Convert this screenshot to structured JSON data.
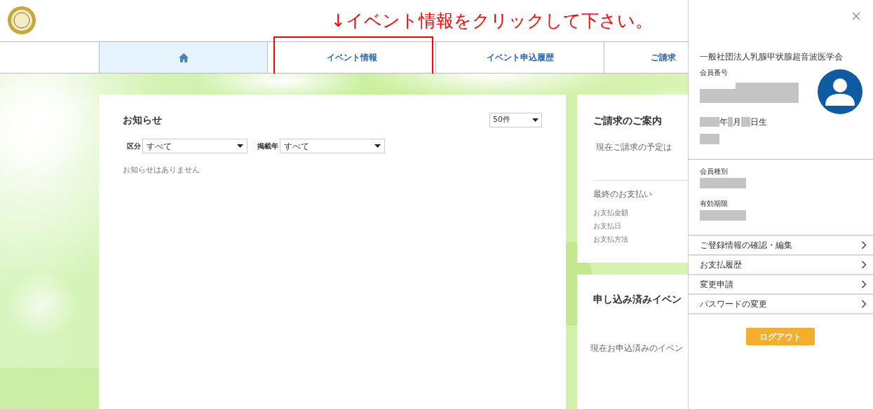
{
  "annotation": {
    "text": "↓イベント情報をクリックして下さい。"
  },
  "nav": [
    {
      "kind": "home",
      "selected": true,
      "annotated": false
    },
    {
      "kind": "text",
      "label": "イベント情報",
      "selected": false,
      "annotated": true
    },
    {
      "kind": "text",
      "label": "イベント申込履歴",
      "selected": false,
      "annotated": false
    },
    {
      "kind": "text",
      "label": "ご請求",
      "selected": false,
      "annotated": false
    }
  ],
  "notices": {
    "title": "お知らせ",
    "per_page": "50件",
    "filters": [
      {
        "label": "区分",
        "value": "すべて"
      },
      {
        "label": "掲載年",
        "value": "すべて"
      }
    ],
    "empty_message": "お知らせはありません"
  },
  "billing": {
    "title": "ご請求のご案内",
    "message": "現在ご請求の予定は",
    "last_payment": {
      "title": "最終のお支払い",
      "fields": [
        "お支払金額",
        "お支払日",
        "お支払方法"
      ]
    }
  },
  "events": {
    "title": "申し込み済みイベン",
    "message": "現在お申込済みのイベン"
  },
  "drawer": {
    "organization": "一般社団法人乳腺甲状腺超音波医学会",
    "member_number_label": "会員番号",
    "birth_date": {
      "year_suffix": "年",
      "month_suffix": "月",
      "day_suffix": "日生"
    },
    "member_type_label": "会員種別",
    "expiry_label": "有効期限",
    "menu": [
      "ご登録情報の確認・編集",
      "お支払履歴",
      "変更申請",
      "パスワードの変更"
    ],
    "logout": "ログアウト"
  }
}
